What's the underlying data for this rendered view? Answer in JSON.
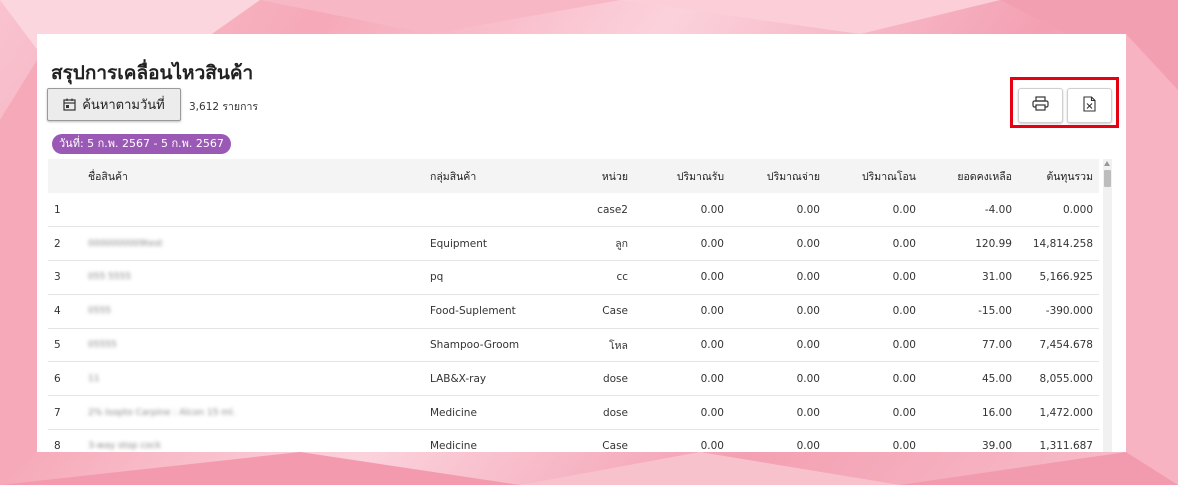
{
  "page": {
    "title": "สรุปการเคลื่อนไหวสินค้า",
    "search_button_label": "ค้นหาตามวันที่",
    "record_count": "3,612 รายการ",
    "date_chip": "วันที่: 5 ก.พ. 2567 - 5 ก.พ. 2567",
    "accent_color": "#9b59b6",
    "highlight_color": "#e60012"
  },
  "toolbar": {
    "print_icon": "printer-icon",
    "excel_icon": "excel-file-icon"
  },
  "table": {
    "columns": [
      "ชื่อสินค้า",
      "กลุ่มสินค้า",
      "หน่วย",
      "ปริมาณรับ",
      "ปริมาณจ่าย",
      "ปริมาณโอน",
      "ยอดคงเหลือ",
      "ต้นทุนรวม"
    ],
    "rows": [
      {
        "no": "1",
        "name": "",
        "group": "",
        "unit": "case2",
        "received": "0.00",
        "issued": "0.00",
        "transferred": "0.00",
        "balance": "-4.00",
        "total_cost": "0.000"
      },
      {
        "no": "2",
        "name": "0000000009test",
        "group": "Equipment",
        "unit": "ลูก",
        "received": "0.00",
        "issued": "0.00",
        "transferred": "0.00",
        "balance": "120.99",
        "total_cost": "14,814.258"
      },
      {
        "no": "3",
        "name": "055 5555",
        "group": "pq",
        "unit": "cc",
        "received": "0.00",
        "issued": "0.00",
        "transferred": "0.00",
        "balance": "31.00",
        "total_cost": "5,166.925"
      },
      {
        "no": "4",
        "name": "0555",
        "group": "Food-Suplement",
        "unit": "Case",
        "received": "0.00",
        "issued": "0.00",
        "transferred": "0.00",
        "balance": "-15.00",
        "total_cost": "-390.000"
      },
      {
        "no": "5",
        "name": "05555",
        "group": "Shampoo-Groom",
        "unit": "โหล",
        "received": "0.00",
        "issued": "0.00",
        "transferred": "0.00",
        "balance": "77.00",
        "total_cost": "7,454.678"
      },
      {
        "no": "6",
        "name": "11",
        "group": "LAB&X-ray",
        "unit": "dose",
        "received": "0.00",
        "issued": "0.00",
        "transferred": "0.00",
        "balance": "45.00",
        "total_cost": "8,055.000"
      },
      {
        "no": "7",
        "name": "2% Isopto Carpine : Alcon 15 ml.",
        "group": "Medicine",
        "unit": "dose",
        "received": "0.00",
        "issued": "0.00",
        "transferred": "0.00",
        "balance": "16.00",
        "total_cost": "1,472.000"
      },
      {
        "no": "8",
        "name": "3-way stop cock",
        "group": "Medicine",
        "unit": "Case",
        "received": "0.00",
        "issued": "0.00",
        "transferred": "0.00",
        "balance": "39.00",
        "total_cost": "1,311.687"
      }
    ]
  }
}
